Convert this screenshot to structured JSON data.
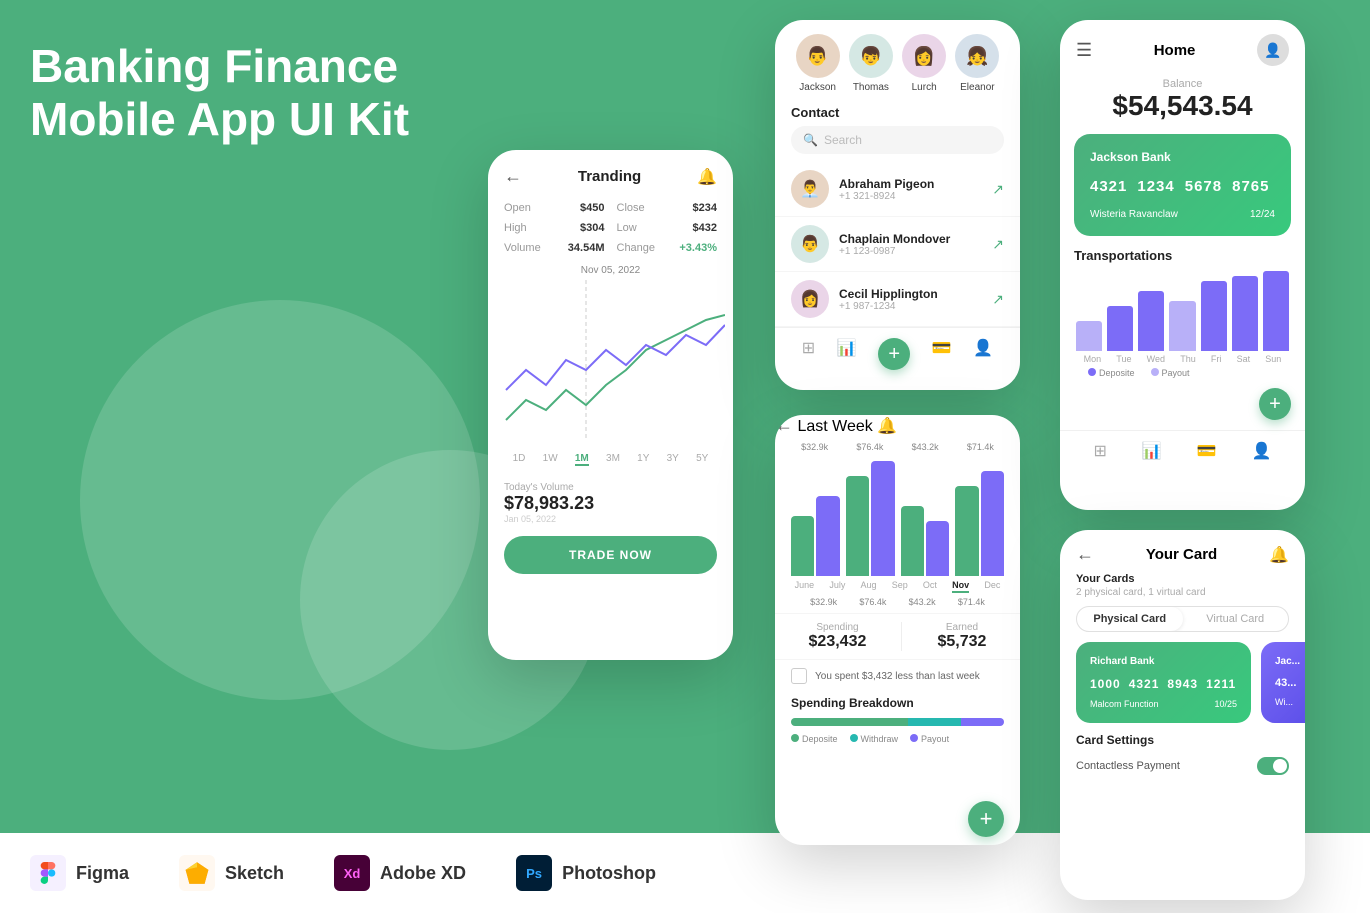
{
  "hero": {
    "title_line1": "Banking Finance",
    "title_line2": "Mobile App UI Kit"
  },
  "tools": [
    {
      "name": "Figma",
      "icon": "F",
      "color": "#a259ff",
      "bg": "#f5f0ff"
    },
    {
      "name": "Sketch",
      "icon": "S",
      "color": "#f7a928",
      "bg": "#fff8f0"
    },
    {
      "name": "Adobe XD",
      "icon": "Xd",
      "color": "#ff61f6",
      "bg": "#f0eaff"
    },
    {
      "name": "Photoshop",
      "icon": "Ps",
      "color": "#2c8af7",
      "bg": "#e8f4ff"
    }
  ],
  "trending": {
    "title": "Tranding",
    "stats": [
      {
        "label": "Open",
        "value": "$450"
      },
      {
        "label": "Close",
        "value": "$234"
      },
      {
        "label": "High",
        "value": "$304"
      },
      {
        "label": "Low",
        "value": "$432"
      },
      {
        "label": "Volume",
        "value": "34.54M"
      },
      {
        "label": "Change",
        "value": "+3.43%",
        "positive": true
      }
    ],
    "chart_date": "Nov 05, 2022",
    "time_tabs": [
      "1D",
      "1W",
      "1M",
      "3M",
      "1Y",
      "3Y",
      "5Y"
    ],
    "active_tab": "1M",
    "volume_label": "Today's Volume",
    "volume_value": "$78,983.23",
    "trade_btn": "TRADE NOW"
  },
  "contacts": {
    "avatars": [
      {
        "name": "Jackson",
        "emoji": "👨"
      },
      {
        "name": "Thomas",
        "emoji": "👦"
      },
      {
        "name": "Lurch",
        "emoji": "👩"
      },
      {
        "name": "Eleanor",
        "emoji": "👧"
      }
    ],
    "section_label": "Contact",
    "search_placeholder": "Search",
    "contacts_list": [
      {
        "name": "Abraham Pigeon",
        "phone": "+1 321-8924"
      },
      {
        "name": "Chaplain Mondover",
        "phone": "+1 123-0987"
      },
      {
        "name": "Cecil Hipplington",
        "phone": "+1 987-1234"
      }
    ]
  },
  "lastweek": {
    "title": "Last Week",
    "bar_tops": [
      "$32.9k",
      "$76.4k",
      "$43.2k",
      "$71.4k"
    ],
    "bar_bottoms": [
      "$32.9k",
      "$76.4k",
      "$43.2k",
      "$71.4k"
    ],
    "months": [
      "June",
      "July",
      "Aug",
      "Sep",
      "Oct",
      "Nov",
      "Dec"
    ],
    "active_month": "Nov",
    "spending_label": "Spending",
    "spending_value": "$23,432",
    "earned_label": "Earned",
    "earned_value": "$5,732",
    "alert_text": "You spent $3,432 less than last week",
    "breakdown_title": "Spending Breakdown",
    "legend": [
      "Deposite",
      "Withdraw",
      "Payout"
    ]
  },
  "home": {
    "title": "Home",
    "balance_label": "Balance",
    "balance": "$54,543.54",
    "card_bank": "Jackson Bank",
    "card_number": [
      "4321",
      "1234",
      "5678",
      "8765"
    ],
    "card_holder": "Wisteria Ravanclaw",
    "card_expiry": "12/24",
    "trans_title": "Transportations",
    "days": [
      "Mon",
      "Tue",
      "Wed",
      "Thu",
      "Fri",
      "Sat",
      "Sun"
    ],
    "legend": [
      "Deposite",
      "Payout"
    ]
  },
  "yourcard": {
    "title": "Your Card",
    "cards_title": "Your Cards",
    "cards_count": "2 physical card, 1 virtual card",
    "tab_physical": "Physical Card",
    "tab_virtual": "Virtual Card",
    "card1_bank": "Richard Bank",
    "card1_number": [
      "1000",
      "4321",
      "8943",
      "1211"
    ],
    "card1_holder": "Malcom Function",
    "card1_expiry": "10/25",
    "card2_bank": "Jac...",
    "card2_holder": "Wi...",
    "settings_title": "Card Settings",
    "contactless_label": "Contactless Payment"
  }
}
